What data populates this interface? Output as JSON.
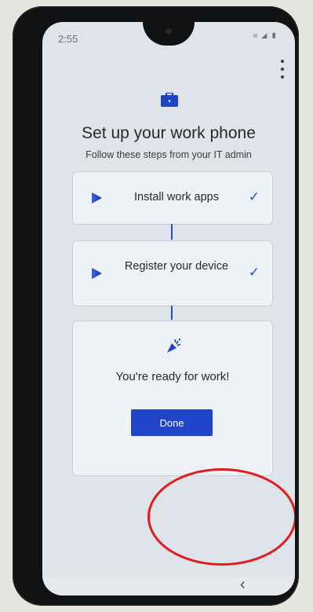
{
  "status_bar": {
    "time": "2:55",
    "icons": "⌗ ◢ ▮"
  },
  "header": {
    "title": "Set up your work phone",
    "subtitle": "Follow these steps from your IT admin"
  },
  "steps": [
    {
      "label": "Install work apps",
      "complete": true
    },
    {
      "label": "Register your device",
      "complete": true
    }
  ],
  "final_card": {
    "message": "You're ready for work!",
    "button_label": "Done"
  },
  "nav": {
    "back_glyph": "‹"
  },
  "colors": {
    "accent": "#1f44c9",
    "annotation": "#e21b1b",
    "screen_bg": "#dfe4ea"
  },
  "icons": {
    "header": "briefcase-icon",
    "steps": "play-store-icon",
    "complete": "checkmark-icon",
    "final": "party-popper-icon",
    "menu": "more-vert-icon"
  }
}
